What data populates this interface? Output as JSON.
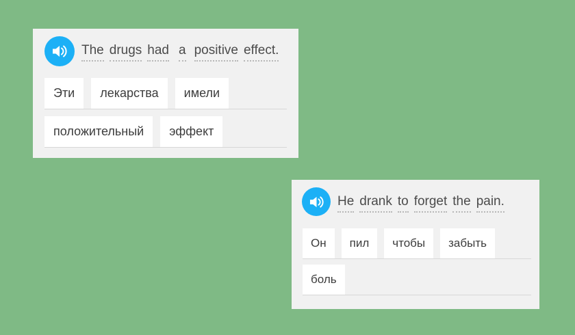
{
  "cards": [
    {
      "prompt_words": [
        "The",
        "drugs",
        "had",
        "a",
        "positive",
        "effect."
      ],
      "row1": [
        "Эти",
        "лекарства",
        "имели"
      ],
      "row2": [
        "положительный",
        "эффект"
      ]
    },
    {
      "prompt_words": [
        "He",
        "drank",
        "to",
        "forget",
        "the",
        "pain."
      ],
      "row1": [
        "Он",
        "пил",
        "чтобы",
        "забыть"
      ],
      "row2": [
        "боль"
      ]
    }
  ],
  "colors": {
    "background": "#7fba85",
    "card": "#f1f1f1",
    "speaker": "#1cb0f6",
    "tile": "#ffffff",
    "text": "#4b4b4b"
  },
  "icons": {
    "speaker": "speaker-icon"
  }
}
